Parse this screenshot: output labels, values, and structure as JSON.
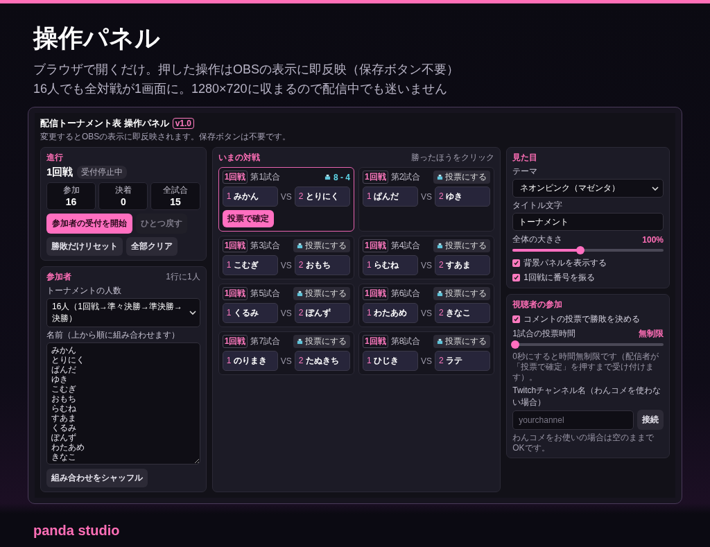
{
  "hero": {
    "title": "操作パネル",
    "lines": [
      "ブラウザで開くだけ。押した操作はOBSの表示に即反映（保存ボタン不要）",
      "16人でも全対戦が1画面に。1280×720に収まるので配信中でも迷いません"
    ]
  },
  "panel": {
    "title": "配信トーナメント表 操作パネル",
    "version": "v1.0",
    "subtitle": "変更するとOBSの表示に即反映されます。保存ボタンは不要です。"
  },
  "progress": {
    "heading": "進行",
    "round": "1回戦",
    "status": "受付停止中",
    "stats": [
      {
        "label": "参加",
        "value": "16"
      },
      {
        "label": "決着",
        "value": "0"
      },
      {
        "label": "全試合",
        "value": "15"
      }
    ],
    "buttons": [
      {
        "label": "参加者の受付を開始",
        "kind": "primary",
        "disabled": false
      },
      {
        "label": "ひとつ戻す",
        "kind": "plain",
        "disabled": true
      },
      {
        "label": "勝敗だけリセット",
        "kind": "plain",
        "disabled": false
      },
      {
        "label": "全部クリア",
        "kind": "plain",
        "disabled": false
      }
    ]
  },
  "participants": {
    "heading": "参加者",
    "hint": "1行に1人",
    "count_label": "トーナメントの人数",
    "count_value": "16人（1回戦→準々決勝→準決勝→決勝）",
    "names_label": "名前（上から順に組み合わせます）",
    "names": [
      "みかん",
      "とりにく",
      "ぱんだ",
      "ゆき",
      "こむぎ",
      "おもち",
      "らむね",
      "すあま",
      "くるみ",
      "ぽんず",
      "わたあめ",
      "きなこ"
    ],
    "shuffle_button": "組み合わせをシャッフル"
  },
  "matches": {
    "heading": "いまの対戦",
    "hint": "勝ったほうをクリック",
    "items": [
      {
        "round": "1回戦",
        "label": "第1試合",
        "voting": true,
        "score": "8 - 4",
        "confirm": "投票で確定",
        "vs": "VS",
        "players": [
          {
            "seed": "1",
            "name": "みかん"
          },
          {
            "seed": "2",
            "name": "とりにく"
          }
        ]
      },
      {
        "round": "1回戦",
        "label": "第2試合",
        "voting": false,
        "vote_button": "投票にする",
        "vs": "VS",
        "players": [
          {
            "seed": "1",
            "name": "ぱんだ"
          },
          {
            "seed": "2",
            "name": "ゆき"
          }
        ]
      },
      {
        "round": "1回戦",
        "label": "第3試合",
        "voting": false,
        "vote_button": "投票にする",
        "vs": "VS",
        "players": [
          {
            "seed": "1",
            "name": "こむぎ"
          },
          {
            "seed": "2",
            "name": "おもち"
          }
        ]
      },
      {
        "round": "1回戦",
        "label": "第4試合",
        "voting": false,
        "vote_button": "投票にする",
        "vs": "VS",
        "players": [
          {
            "seed": "1",
            "name": "らむね"
          },
          {
            "seed": "2",
            "name": "すあま"
          }
        ]
      },
      {
        "round": "1回戦",
        "label": "第5試合",
        "voting": false,
        "vote_button": "投票にする",
        "vs": "VS",
        "players": [
          {
            "seed": "1",
            "name": "くるみ"
          },
          {
            "seed": "2",
            "name": "ぽんず"
          }
        ]
      },
      {
        "round": "1回戦",
        "label": "第6試合",
        "voting": false,
        "vote_button": "投票にする",
        "vs": "VS",
        "players": [
          {
            "seed": "1",
            "name": "わたあめ"
          },
          {
            "seed": "2",
            "name": "きなこ"
          }
        ]
      },
      {
        "round": "1回戦",
        "label": "第7試合",
        "voting": false,
        "vote_button": "投票にする",
        "vs": "VS",
        "players": [
          {
            "seed": "1",
            "name": "のりまき"
          },
          {
            "seed": "2",
            "name": "たぬきち"
          }
        ]
      },
      {
        "round": "1回戦",
        "label": "第8試合",
        "voting": false,
        "vote_button": "投票にする",
        "vs": "VS",
        "players": [
          {
            "seed": "1",
            "name": "ひじき"
          },
          {
            "seed": "2",
            "name": "ラテ"
          }
        ]
      }
    ]
  },
  "appearance": {
    "heading": "見た目",
    "theme_label": "テーマ",
    "theme_value": "ネオンピンク（マゼンタ）",
    "title_label": "タイトル文字",
    "title_value": "トーナメント",
    "size_label": "全体の大きさ",
    "size_reading": "100%",
    "size_slider": {
      "level": 0.45
    },
    "checks": [
      {
        "label": "背景パネルを表示する",
        "checked": true
      },
      {
        "label": "1回戦に番号を振る",
        "checked": true
      }
    ]
  },
  "viewers": {
    "heading": "視聴者の参加",
    "checks": [
      {
        "label": "コメントの投票で勝敗を決める",
        "checked": true
      }
    ],
    "time_label": "1試合の投票時間",
    "time_reading": "無制限",
    "time_slider": {
      "level": 0
    },
    "note": "0秒にすると時間無制限です（配信者が「投票で確定」を押すまで受け付けます）。",
    "channel_label": "Twitchチャンネル名（わんコメを使わない場合）",
    "channel_placeholder": "yourchannel",
    "connect_button": "接続",
    "footer_note": "わんコメをお使いの場合は空のままでOKです。"
  },
  "brand": "panda studio"
}
